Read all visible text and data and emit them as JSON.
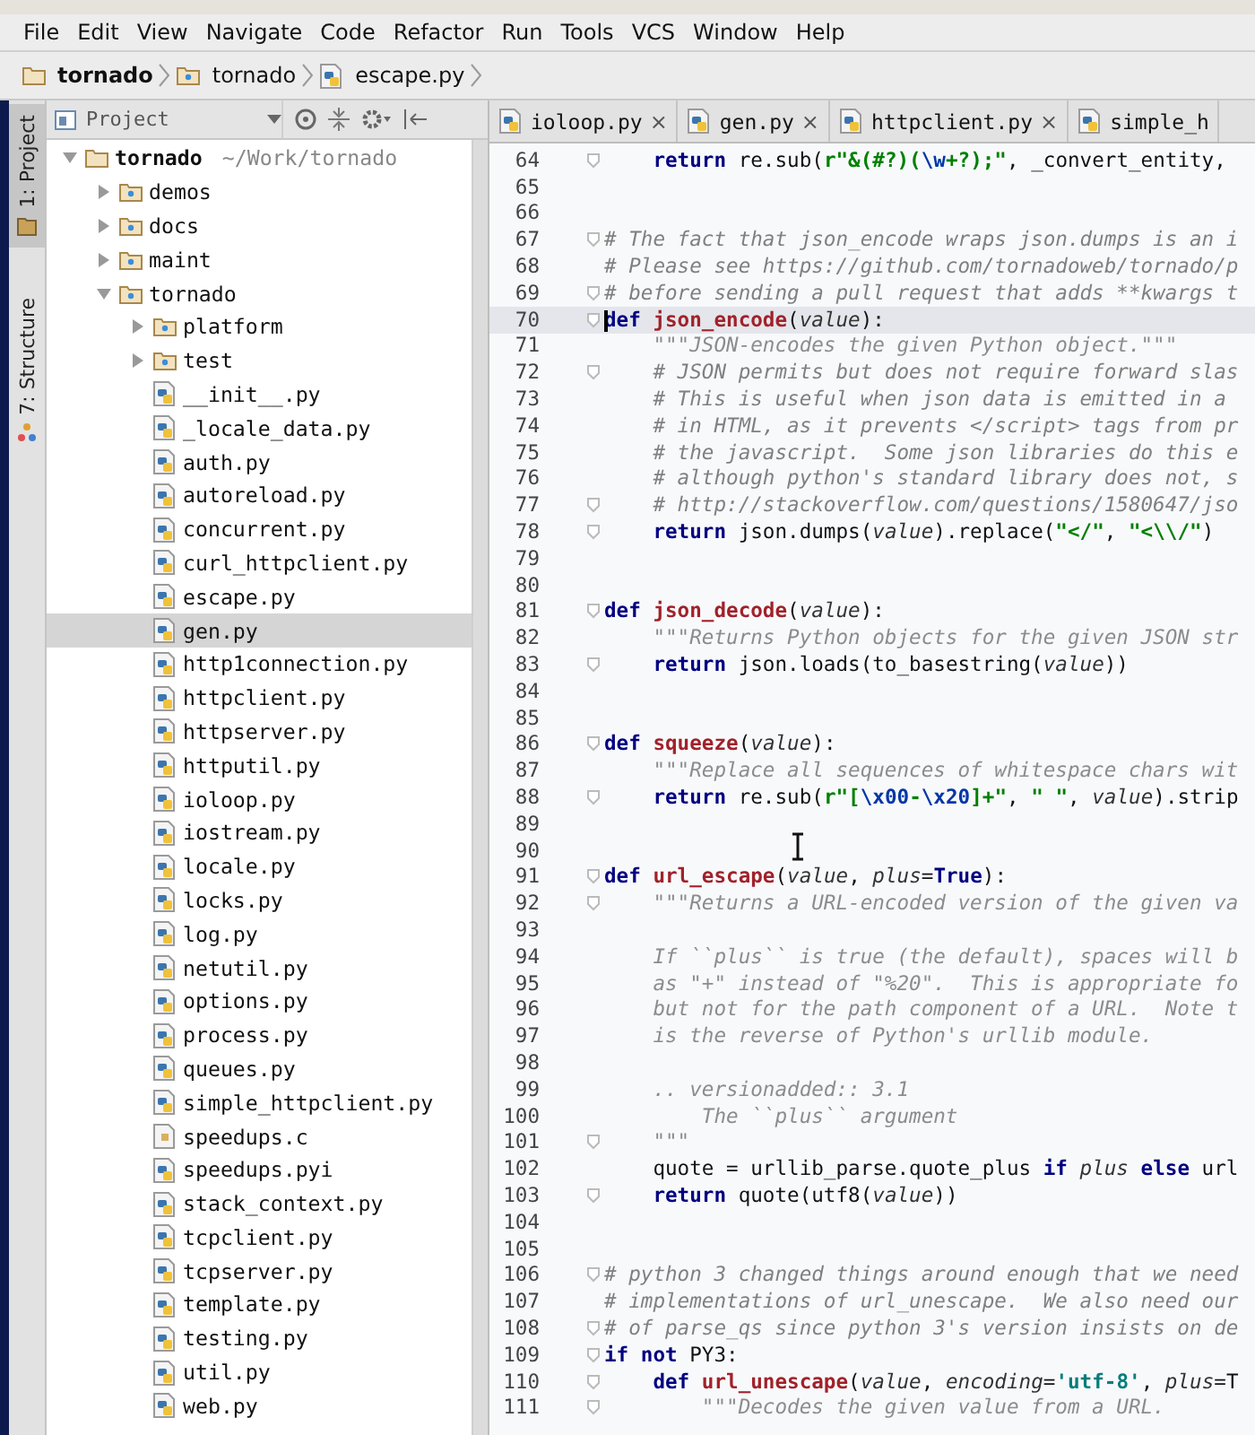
{
  "menu": [
    "File",
    "Edit",
    "View",
    "Navigate",
    "Code",
    "Refactor",
    "Run",
    "Tools",
    "VCS",
    "Window",
    "Help"
  ],
  "breadcrumb": [
    {
      "label": "tornado",
      "kind": "project"
    },
    {
      "label": "tornado",
      "kind": "folder"
    },
    {
      "label": "escape.py",
      "kind": "python"
    }
  ],
  "side_tabs": [
    {
      "label": "1: Project",
      "selected": true
    },
    {
      "label": "7: Structure",
      "selected": false
    }
  ],
  "project_panel": {
    "title": "Project"
  },
  "tree": [
    {
      "name": "tornado",
      "path": "~/Work/tornado",
      "kind": "project",
      "expanded": true,
      "selected": false,
      "children": [
        {
          "name": "demos",
          "kind": "folder",
          "expanded": false,
          "selected": false
        },
        {
          "name": "docs",
          "kind": "folder",
          "expanded": false,
          "selected": false
        },
        {
          "name": "maint",
          "kind": "folder",
          "expanded": false,
          "selected": false
        },
        {
          "name": "tornado",
          "kind": "folder",
          "expanded": true,
          "selected": false,
          "children": [
            {
              "name": "platform",
              "kind": "folder",
              "expanded": false,
              "selected": false
            },
            {
              "name": "test",
              "kind": "folder",
              "expanded": false,
              "selected": false
            },
            {
              "name": "__init__.py",
              "kind": "python",
              "selected": false
            },
            {
              "name": "_locale_data.py",
              "kind": "python",
              "selected": false
            },
            {
              "name": "auth.py",
              "kind": "python",
              "selected": false
            },
            {
              "name": "autoreload.py",
              "kind": "python",
              "selected": false
            },
            {
              "name": "concurrent.py",
              "kind": "python",
              "selected": false
            },
            {
              "name": "curl_httpclient.py",
              "kind": "python",
              "selected": false
            },
            {
              "name": "escape.py",
              "kind": "python",
              "selected": false
            },
            {
              "name": "gen.py",
              "kind": "python",
              "selected": true
            },
            {
              "name": "http1connection.py",
              "kind": "python",
              "selected": false
            },
            {
              "name": "httpclient.py",
              "kind": "python",
              "selected": false
            },
            {
              "name": "httpserver.py",
              "kind": "python",
              "selected": false
            },
            {
              "name": "httputil.py",
              "kind": "python",
              "selected": false
            },
            {
              "name": "ioloop.py",
              "kind": "python",
              "selected": false
            },
            {
              "name": "iostream.py",
              "kind": "python",
              "selected": false
            },
            {
              "name": "locale.py",
              "kind": "python",
              "selected": false
            },
            {
              "name": "locks.py",
              "kind": "python",
              "selected": false
            },
            {
              "name": "log.py",
              "kind": "python",
              "selected": false
            },
            {
              "name": "netutil.py",
              "kind": "python",
              "selected": false
            },
            {
              "name": "options.py",
              "kind": "python",
              "selected": false
            },
            {
              "name": "process.py",
              "kind": "python",
              "selected": false
            },
            {
              "name": "queues.py",
              "kind": "python",
              "selected": false
            },
            {
              "name": "simple_httpclient.py",
              "kind": "python",
              "selected": false
            },
            {
              "name": "speedups.c",
              "kind": "c",
              "selected": false
            },
            {
              "name": "speedups.pyi",
              "kind": "python",
              "selected": false
            },
            {
              "name": "stack_context.py",
              "kind": "python",
              "selected": false
            },
            {
              "name": "tcpclient.py",
              "kind": "python",
              "selected": false
            },
            {
              "name": "tcpserver.py",
              "kind": "python",
              "selected": false
            },
            {
              "name": "template.py",
              "kind": "python",
              "selected": false
            },
            {
              "name": "testing.py",
              "kind": "python",
              "selected": false
            },
            {
              "name": "util.py",
              "kind": "python",
              "selected": false
            },
            {
              "name": "web.py",
              "kind": "python",
              "selected": false
            }
          ]
        }
      ]
    }
  ],
  "editor_tabs": [
    {
      "label": "ioloop.py",
      "selected": false,
      "closable": true
    },
    {
      "label": "gen.py",
      "selected": false,
      "closable": true
    },
    {
      "label": "httpclient.py",
      "selected": false,
      "closable": true
    },
    {
      "label": "simple_h",
      "selected": false,
      "closable": false
    }
  ],
  "close_symbol": "×",
  "code": [
    {
      "num": "64",
      "current": false,
      "fold": true,
      "tokens": [
        {
          "kind": "keyword",
          "text": "    return"
        },
        {
          "kind": "plain",
          "text": " re.sub("
        },
        {
          "kind": "string",
          "text": "r\"&(#?)("
        },
        {
          "kind": "escape",
          "text": "\\w"
        },
        {
          "kind": "string",
          "text": "+?);\""
        },
        {
          "kind": "plain",
          "text": ", _convert_entity,"
        }
      ]
    },
    {
      "num": "65",
      "current": false,
      "fold": false
    },
    {
      "num": "66",
      "current": false,
      "fold": false
    },
    {
      "num": "67",
      "current": false,
      "fold": true,
      "tokens": [
        {
          "kind": "comment",
          "text": "# The fact that json_encode wraps json.dumps is an i"
        }
      ]
    },
    {
      "num": "68",
      "current": false,
      "fold": false,
      "tokens": [
        {
          "kind": "comment",
          "text": "# Please see https://github.com/tornadoweb/tornado/p"
        }
      ]
    },
    {
      "num": "69",
      "current": false,
      "fold": true,
      "tokens": [
        {
          "kind": "comment",
          "text": "# before sending a pull request that adds **kwargs t"
        }
      ]
    },
    {
      "num": "70",
      "current": true,
      "fold": true,
      "tokens": [
        {
          "kind": "keyword",
          "text": "def"
        },
        {
          "kind": "function",
          "text": " json_encode"
        },
        {
          "kind": "plain",
          "text": "("
        },
        {
          "kind": "param",
          "text": "value"
        },
        {
          "kind": "plain",
          "text": "):"
        }
      ]
    },
    {
      "num": "71",
      "current": false,
      "fold": false,
      "tokens": [
        {
          "kind": "docstring",
          "text": "    \"\"\"JSON-encodes the given Python object.\"\"\""
        }
      ]
    },
    {
      "num": "72",
      "current": false,
      "fold": true,
      "tokens": [
        {
          "kind": "comment",
          "text": "    # JSON permits but does not require forward slas"
        }
      ]
    },
    {
      "num": "73",
      "current": false,
      "fold": false,
      "tokens": [
        {
          "kind": "comment",
          "text": "    # This is useful when json data is emitted in a"
        }
      ]
    },
    {
      "num": "74",
      "current": false,
      "fold": false,
      "tokens": [
        {
          "kind": "comment",
          "text": "    # in HTML, as it prevents </script> tags from pr"
        }
      ]
    },
    {
      "num": "75",
      "current": false,
      "fold": false,
      "tokens": [
        {
          "kind": "comment",
          "text": "    # the javascript.  Some json libraries do this e"
        }
      ]
    },
    {
      "num": "76",
      "current": false,
      "fold": false,
      "tokens": [
        {
          "kind": "comment",
          "text": "    # although python's standard library does not, s"
        }
      ]
    },
    {
      "num": "77",
      "current": false,
      "fold": true,
      "tokens": [
        {
          "kind": "comment",
          "text": "    # http://stackoverflow.com/questions/1580647/jso"
        }
      ]
    },
    {
      "num": "78",
      "current": false,
      "fold": true,
      "tokens": [
        {
          "kind": "keyword",
          "text": "    return"
        },
        {
          "kind": "plain",
          "text": " json.dumps("
        },
        {
          "kind": "param",
          "text": "value"
        },
        {
          "kind": "plain",
          "text": ").replace("
        },
        {
          "kind": "string",
          "text": "\"</\""
        },
        {
          "kind": "plain",
          "text": ", "
        },
        {
          "kind": "string",
          "text": "\"<\\\\/\""
        },
        {
          "kind": "plain",
          "text": ")"
        }
      ]
    },
    {
      "num": "79",
      "current": false,
      "fold": false
    },
    {
      "num": "80",
      "current": false,
      "fold": false
    },
    {
      "num": "81",
      "current": false,
      "fold": true,
      "tokens": [
        {
          "kind": "keyword",
          "text": "def"
        },
        {
          "kind": "function",
          "text": " json_decode"
        },
        {
          "kind": "plain",
          "text": "("
        },
        {
          "kind": "param",
          "text": "value"
        },
        {
          "kind": "plain",
          "text": "):"
        }
      ]
    },
    {
      "num": "82",
      "current": false,
      "fold": false,
      "tokens": [
        {
          "kind": "docstring",
          "text": "    \"\"\"Returns Python objects for the given JSON str"
        }
      ]
    },
    {
      "num": "83",
      "current": false,
      "fold": true,
      "tokens": [
        {
          "kind": "keyword",
          "text": "    return"
        },
        {
          "kind": "plain",
          "text": " json.loads(to_basestring("
        },
        {
          "kind": "param",
          "text": "value"
        },
        {
          "kind": "plain",
          "text": "))"
        }
      ]
    },
    {
      "num": "84",
      "current": false,
      "fold": false
    },
    {
      "num": "85",
      "current": false,
      "fold": false
    },
    {
      "num": "86",
      "current": false,
      "fold": true,
      "tokens": [
        {
          "kind": "keyword",
          "text": "def"
        },
        {
          "kind": "function",
          "text": " squeeze"
        },
        {
          "kind": "plain",
          "text": "("
        },
        {
          "kind": "param",
          "text": "value"
        },
        {
          "kind": "plain",
          "text": "):"
        }
      ]
    },
    {
      "num": "87",
      "current": false,
      "fold": false,
      "tokens": [
        {
          "kind": "docstring",
          "text": "    \"\"\"Replace all sequences of whitespace chars wit"
        }
      ]
    },
    {
      "num": "88",
      "current": false,
      "fold": true,
      "tokens": [
        {
          "kind": "keyword",
          "text": "    return"
        },
        {
          "kind": "plain",
          "text": " re.sub("
        },
        {
          "kind": "string",
          "text": "r\"["
        },
        {
          "kind": "escape",
          "text": "\\x00"
        },
        {
          "kind": "string",
          "text": "-"
        },
        {
          "kind": "escape",
          "text": "\\x20"
        },
        {
          "kind": "string",
          "text": "]+\""
        },
        {
          "kind": "plain",
          "text": ", "
        },
        {
          "kind": "string",
          "text": "\" \""
        },
        {
          "kind": "plain",
          "text": ", "
        },
        {
          "kind": "param",
          "text": "value"
        },
        {
          "kind": "plain",
          "text": ").strip"
        }
      ]
    },
    {
      "num": "89",
      "current": false,
      "fold": false
    },
    {
      "num": "90",
      "current": false,
      "fold": false
    },
    {
      "num": "91",
      "current": false,
      "fold": true,
      "tokens": [
        {
          "kind": "keyword",
          "text": "def"
        },
        {
          "kind": "function",
          "text": " url_escape"
        },
        {
          "kind": "plain",
          "text": "("
        },
        {
          "kind": "param",
          "text": "value"
        },
        {
          "kind": "plain",
          "text": ", "
        },
        {
          "kind": "param",
          "text": "plus"
        },
        {
          "kind": "plain",
          "text": "="
        },
        {
          "kind": "keyword",
          "text": "True"
        },
        {
          "kind": "plain",
          "text": "):"
        }
      ]
    },
    {
      "num": "92",
      "current": false,
      "fold": true,
      "tokens": [
        {
          "kind": "docstring",
          "text": "    \"\"\"Returns a URL-encoded version of the given va"
        }
      ]
    },
    {
      "num": "93",
      "current": false,
      "fold": false
    },
    {
      "num": "94",
      "current": false,
      "fold": false,
      "tokens": [
        {
          "kind": "docstring",
          "text": "    If ``plus`` is true (the default), spaces will b"
        }
      ]
    },
    {
      "num": "95",
      "current": false,
      "fold": false,
      "tokens": [
        {
          "kind": "docstring",
          "text": "    as \"+\" instead of \"%20\".  This is appropriate fo"
        }
      ]
    },
    {
      "num": "96",
      "current": false,
      "fold": false,
      "tokens": [
        {
          "kind": "docstring",
          "text": "    but not for the path component of a URL.  Note t"
        }
      ]
    },
    {
      "num": "97",
      "current": false,
      "fold": false,
      "tokens": [
        {
          "kind": "docstring",
          "text": "    is the reverse of Python's urllib module."
        }
      ]
    },
    {
      "num": "98",
      "current": false,
      "fold": false
    },
    {
      "num": "99",
      "current": false,
      "fold": false,
      "tokens": [
        {
          "kind": "docstring",
          "text": "    .. versionadded:: 3.1"
        }
      ]
    },
    {
      "num": "100",
      "current": false,
      "fold": false,
      "tokens": [
        {
          "kind": "docstring",
          "text": "        The ``plus`` argument"
        }
      ]
    },
    {
      "num": "101",
      "current": false,
      "fold": true,
      "tokens": [
        {
          "kind": "docstring",
          "text": "    \"\"\""
        }
      ]
    },
    {
      "num": "102",
      "current": false,
      "fold": false,
      "tokens": [
        {
          "kind": "plain",
          "text": "    quote = urllib_parse.quote_plus "
        },
        {
          "kind": "keyword",
          "text": "if"
        },
        {
          "kind": "param",
          "text": " plus"
        },
        {
          "kind": "keyword",
          "text": " else"
        },
        {
          "kind": "plain",
          "text": " url"
        }
      ]
    },
    {
      "num": "103",
      "current": false,
      "fold": true,
      "tokens": [
        {
          "kind": "keyword",
          "text": "    return"
        },
        {
          "kind": "plain",
          "text": " quote(utf8("
        },
        {
          "kind": "param",
          "text": "value"
        },
        {
          "kind": "plain",
          "text": "))"
        }
      ]
    },
    {
      "num": "104",
      "current": false,
      "fold": false
    },
    {
      "num": "105",
      "current": false,
      "fold": false
    },
    {
      "num": "106",
      "current": false,
      "fold": true,
      "tokens": [
        {
          "kind": "comment",
          "text": "# python 3 changed things around enough that we need"
        }
      ]
    },
    {
      "num": "107",
      "current": false,
      "fold": false,
      "tokens": [
        {
          "kind": "comment",
          "text": "# implementations of url_unescape.  We also need our"
        }
      ]
    },
    {
      "num": "108",
      "current": false,
      "fold": true,
      "tokens": [
        {
          "kind": "comment",
          "text": "# of parse_qs since python 3's version insists on de"
        }
      ]
    },
    {
      "num": "109",
      "current": false,
      "fold": true,
      "tokens": [
        {
          "kind": "keyword",
          "text": "if not"
        },
        {
          "kind": "plain",
          "text": " PY3:"
        }
      ]
    },
    {
      "num": "110",
      "current": false,
      "fold": true,
      "tokens": [
        {
          "kind": "keyword",
          "text": "    def"
        },
        {
          "kind": "function",
          "text": " url_unescape"
        },
        {
          "kind": "plain",
          "text": "("
        },
        {
          "kind": "param",
          "text": "value"
        },
        {
          "kind": "plain",
          "text": ", "
        },
        {
          "kind": "param",
          "text": "encoding"
        },
        {
          "kind": "plain",
          "text": "="
        },
        {
          "kind": "quoted",
          "text": "'utf-8'"
        },
        {
          "kind": "plain",
          "text": ", "
        },
        {
          "kind": "param",
          "text": "plus"
        },
        {
          "kind": "plain",
          "text": "=T"
        }
      ]
    },
    {
      "num": "111",
      "current": false,
      "fold": true,
      "tokens": [
        {
          "kind": "docstring",
          "text": "        \"\"\"Decodes the given value from a URL."
        }
      ]
    }
  ]
}
